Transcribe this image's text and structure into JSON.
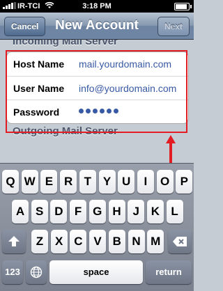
{
  "status": {
    "carrier": "IR-TCI",
    "time": "3:18 PM"
  },
  "nav": {
    "title": "New Account",
    "cancel": "Cancel",
    "next": "Next"
  },
  "incoming": {
    "header": "Incoming Mail Server",
    "rows": [
      {
        "label": "Host Name",
        "value": "mail.yourdomain.com"
      },
      {
        "label": "User Name",
        "value": "info@yourdomain.com"
      },
      {
        "label": "Password",
        "masked_length": 6
      }
    ]
  },
  "outgoing": {
    "header": "Outgoing Mail Server"
  },
  "keyboard": {
    "row1": [
      "Q",
      "W",
      "E",
      "R",
      "T",
      "Y",
      "U",
      "I",
      "O",
      "P"
    ],
    "row2": [
      "A",
      "S",
      "D",
      "F",
      "G",
      "H",
      "J",
      "K",
      "L"
    ],
    "row3": [
      "Z",
      "X",
      "C",
      "V",
      "B",
      "N",
      "M"
    ],
    "numbers": "123",
    "space": "space",
    "return": "return"
  },
  "colors": {
    "highlight": "#e31b23",
    "value_text": "#3859a4"
  }
}
